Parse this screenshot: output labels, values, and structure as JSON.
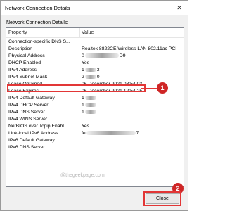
{
  "window": {
    "title": "Network Connection Details",
    "close_glyph": "✕"
  },
  "details_label": "Network Connection Details:",
  "columns": {
    "property": "Property",
    "value": "Value"
  },
  "rows": [
    {
      "property": "Connection-specific DNS S...",
      "value": ""
    },
    {
      "property": "Description",
      "value": "Realtek 8822CE Wireless LAN 802.11ac PCI-"
    },
    {
      "property": "Physical Address",
      "value": "0",
      "value_suffix": "D9",
      "redacted": true
    },
    {
      "property": "DHCP Enabled",
      "value": "Yes"
    },
    {
      "property": "IPv4 Address",
      "value": "1",
      "value_suffix": "3",
      "redacted": true
    },
    {
      "property": "IPv4 Subnet Mask",
      "value": "2",
      "value_suffix": "0",
      "redacted": true
    },
    {
      "property": "Lease Obtained",
      "value": "06 December 2021 08:54:03"
    },
    {
      "property": "Lease Expires",
      "value": "06 December 2021 12:54:25"
    },
    {
      "property": "IPv4 Default Gateway",
      "value": "1",
      "value_suffix": "",
      "redacted": true
    },
    {
      "property": "IPv4 DHCP Server",
      "value": "1",
      "value_suffix": "",
      "redacted": true
    },
    {
      "property": "IPv4 DNS Server",
      "value": "1",
      "value_suffix": "",
      "redacted": true
    },
    {
      "property": "IPv4 WINS Server",
      "value": ""
    },
    {
      "property": "NetBIOS over Tcpip Enabl...",
      "value": "Yes"
    },
    {
      "property": "Link-local IPv6 Address",
      "value": "fe",
      "value_suffix": "7",
      "redacted": true
    },
    {
      "property": "IPv6 Default Gateway",
      "value": ""
    },
    {
      "property": "IPv6 DNS Server",
      "value": ""
    }
  ],
  "annotations": {
    "badge1": "1",
    "badge2": "2"
  },
  "watermark": "@thegeekpage.com",
  "buttons": {
    "close": "Close"
  },
  "colors": {
    "annotation_red": "#e23636",
    "badge_red": "#cf2626"
  }
}
